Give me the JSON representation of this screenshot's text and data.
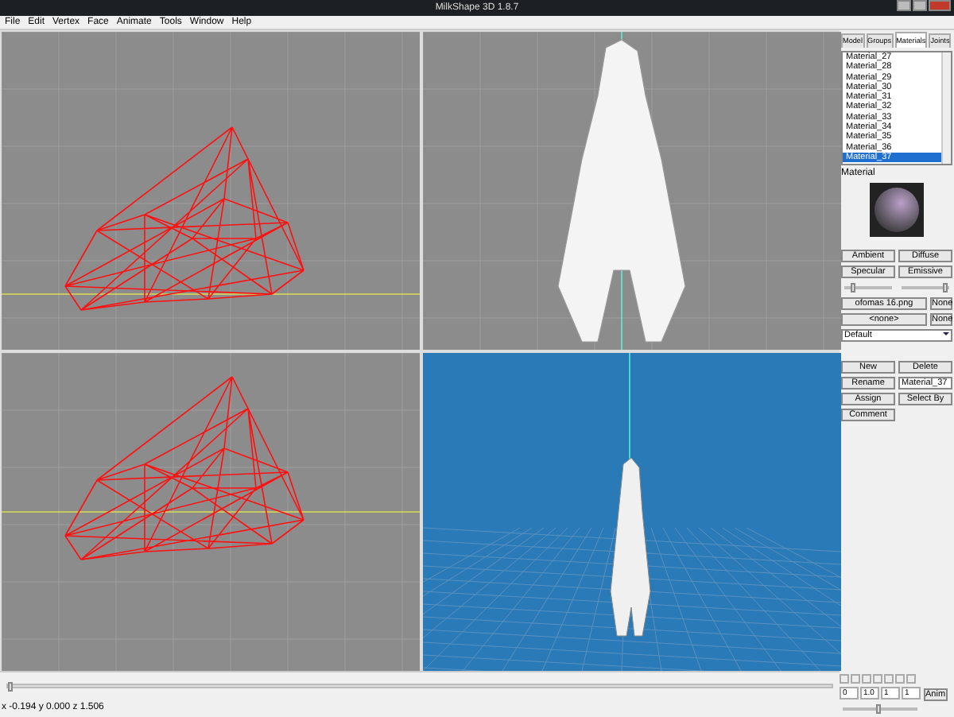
{
  "window": {
    "title": "MilkShape 3D 1.8.7"
  },
  "menu": [
    "File",
    "Edit",
    "Vertex",
    "Face",
    "Animate",
    "Tools",
    "Window",
    "Help"
  ],
  "viewports": [
    {
      "kind": "wireframe"
    },
    {
      "kind": "solid"
    },
    {
      "kind": "wireframe"
    },
    {
      "kind": "perspective"
    }
  ],
  "side_panel": {
    "tabs": [
      {
        "label": "Model",
        "selected": false
      },
      {
        "label": "Groups",
        "selected": false
      },
      {
        "label": "Materials",
        "selected": true
      },
      {
        "label": "Joints",
        "selected": false
      }
    ],
    "materials": [
      {
        "label": "Material_27",
        "selected": false
      },
      {
        "label": "Material_28",
        "selected": false
      },
      {
        "label": "Material_29",
        "selected": false
      },
      {
        "label": "Material_30",
        "selected": false
      },
      {
        "label": "Material_31",
        "selected": false
      },
      {
        "label": "Material_32",
        "selected": false
      },
      {
        "label": "Material_33",
        "selected": false
      },
      {
        "label": "Material_34",
        "selected": false
      },
      {
        "label": "Material_35",
        "selected": false
      },
      {
        "label": "Material_36",
        "selected": false
      },
      {
        "label": "Material_37",
        "selected": true
      }
    ],
    "preview_label": "Material",
    "color_buttons": [
      "Ambient",
      "Diffuse",
      "Specular",
      "Emissive"
    ],
    "sliders": [
      {
        "level": 0.15
      },
      {
        "level": 0.95
      }
    ],
    "textures": [
      {
        "file": "ofomas 16.png",
        "clear": "None"
      },
      {
        "file": "<none>",
        "clear": "None"
      }
    ],
    "mode": "Default",
    "actions": [
      {
        "kind": "button",
        "label": "New"
      },
      {
        "kind": "button",
        "label": "Delete"
      },
      {
        "kind": "button",
        "label": "Rename"
      },
      {
        "kind": "field",
        "value": "Material_37"
      },
      {
        "kind": "button",
        "label": "Assign"
      },
      {
        "kind": "button",
        "label": "Select By"
      },
      {
        "kind": "button",
        "label": "Comment"
      }
    ]
  },
  "timeline": {
    "level": 0.0
  },
  "anim": {
    "fields": [
      "0",
      "1.0",
      "1",
      "1"
    ],
    "button": "Anim",
    "level": 0.5
  },
  "status_bar": "x -0.194 y 0.000 z 1.506"
}
